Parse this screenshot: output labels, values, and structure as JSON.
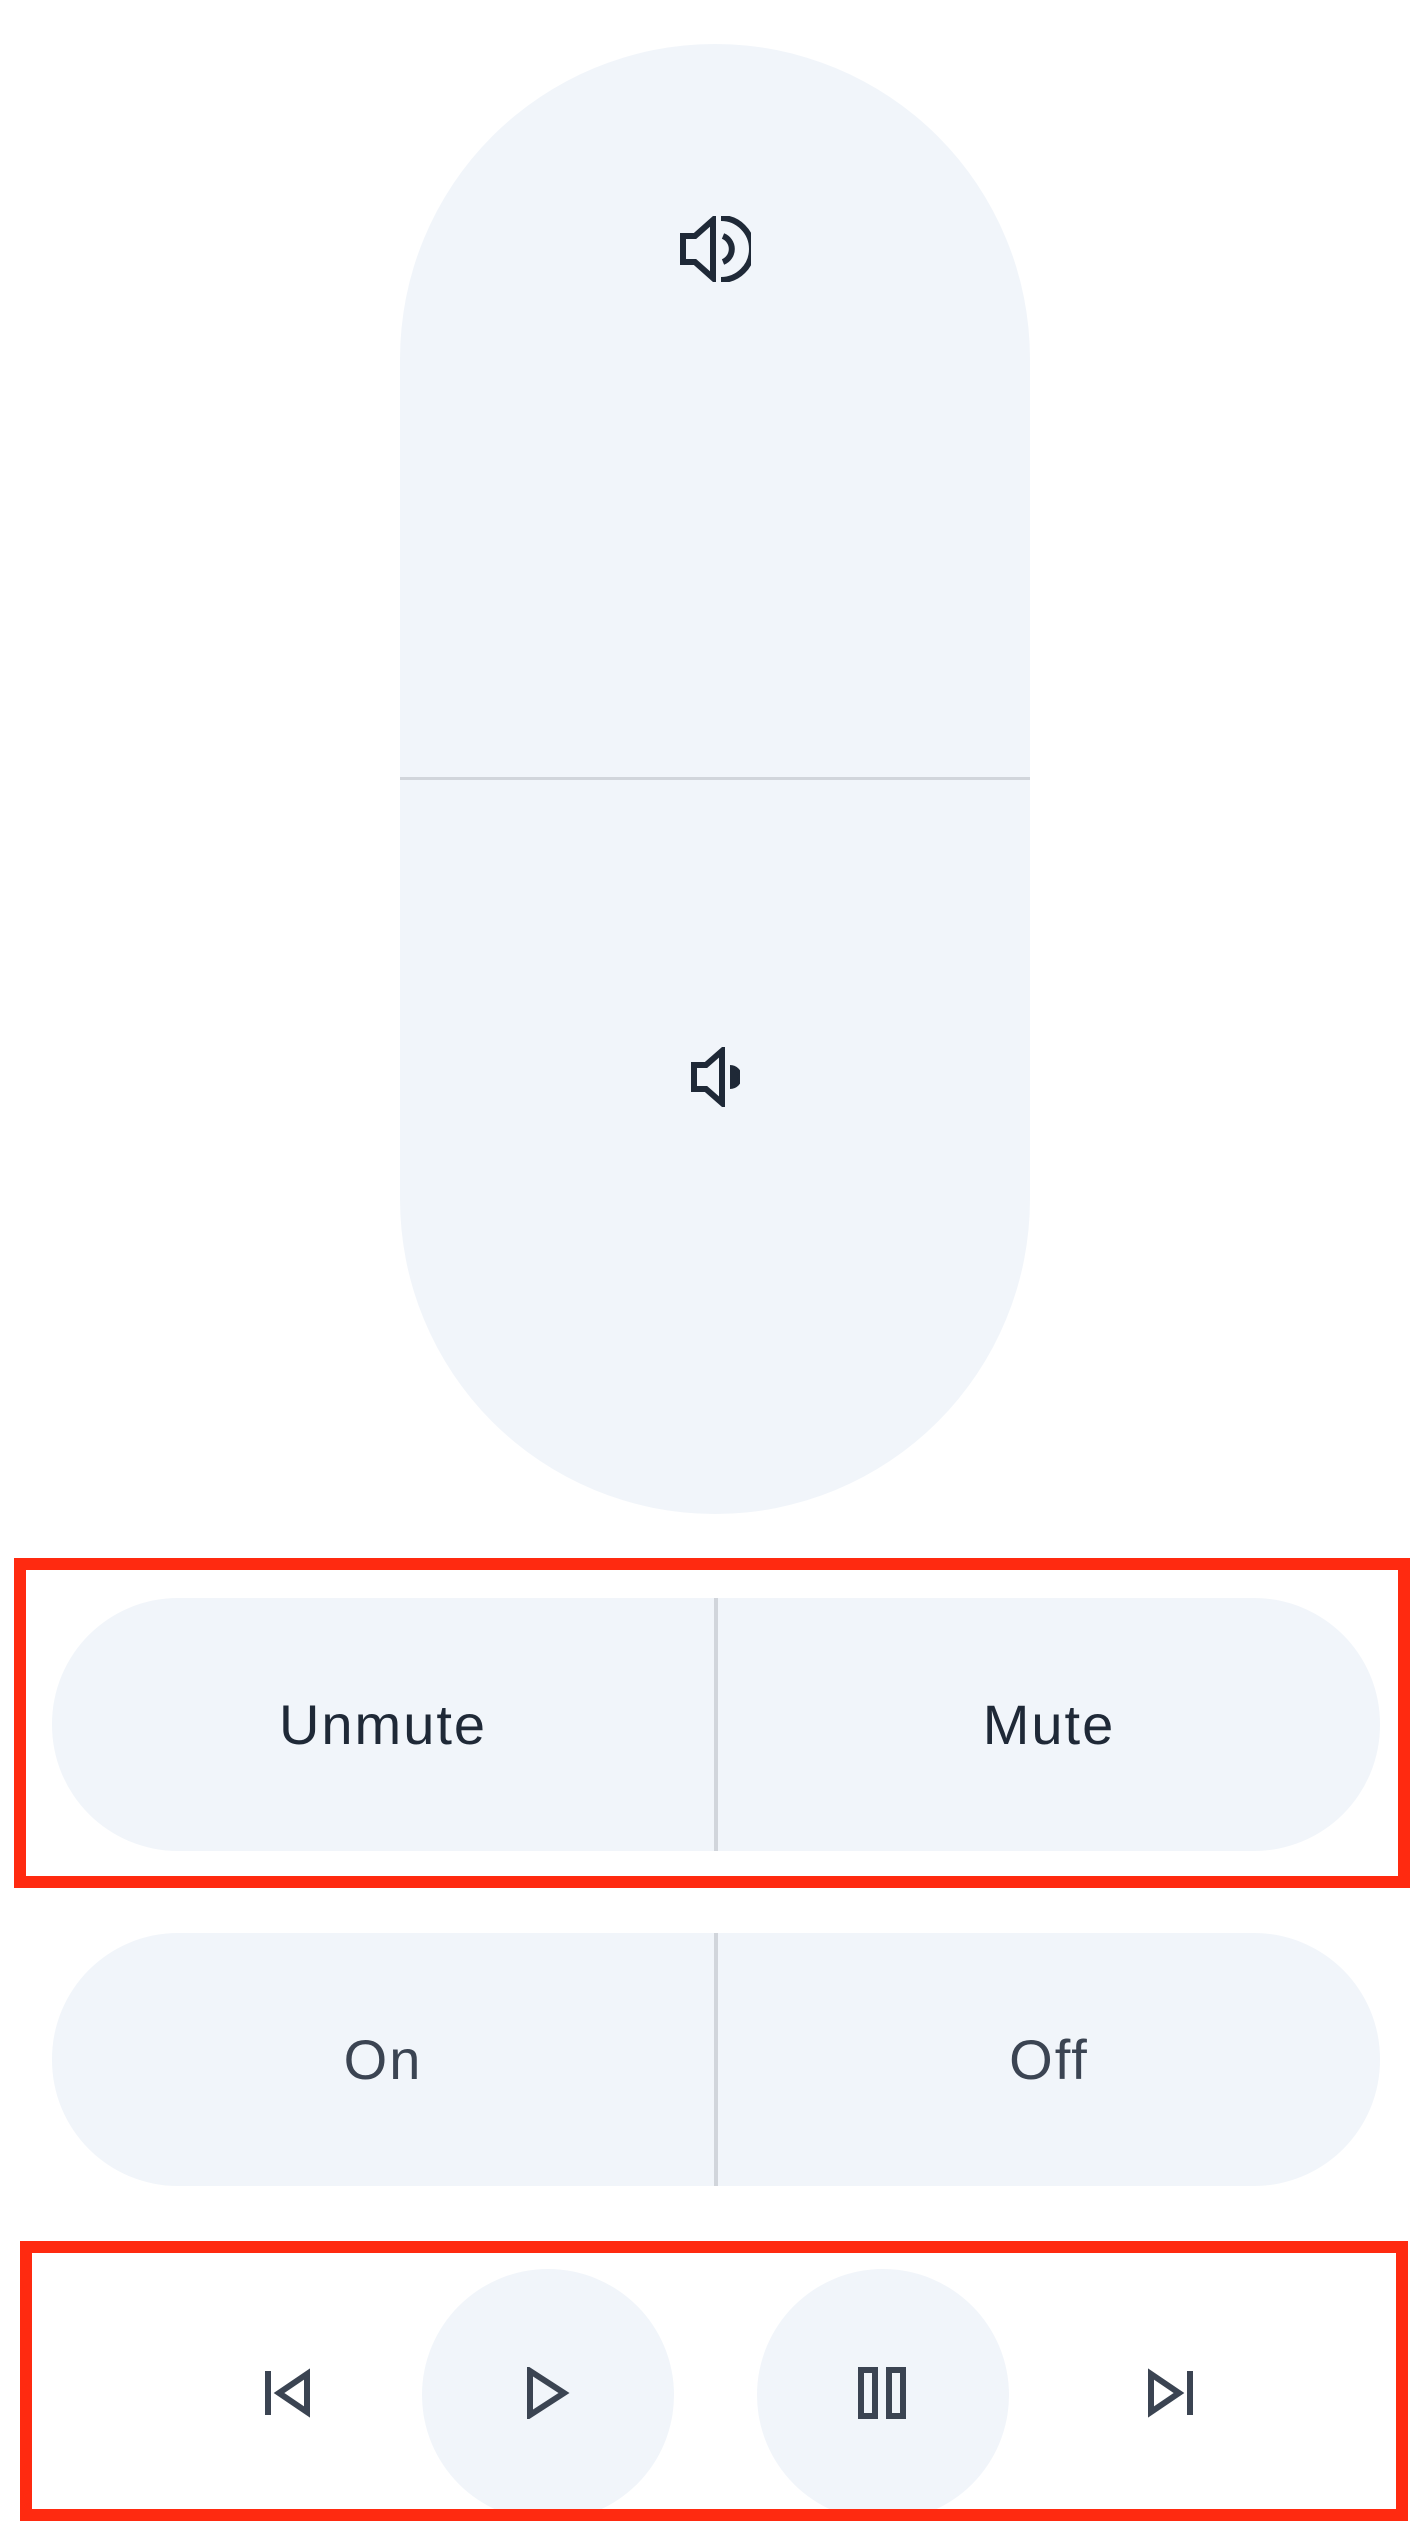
{
  "volume": {
    "up_icon": "volume-up-icon",
    "down_icon": "volume-down-icon"
  },
  "mute_toggle": {
    "left_label": "Unmute",
    "right_label": "Mute"
  },
  "power_toggle": {
    "left_label": "On",
    "right_label": "Off"
  },
  "media_controls": {
    "icons": [
      "skip-previous-icon",
      "play-icon",
      "pause-icon",
      "skip-next-icon"
    ]
  },
  "colors": {
    "pill_background": "#f1f5fa",
    "divider": "#d1d5db",
    "highlight": "#ff2a10"
  }
}
